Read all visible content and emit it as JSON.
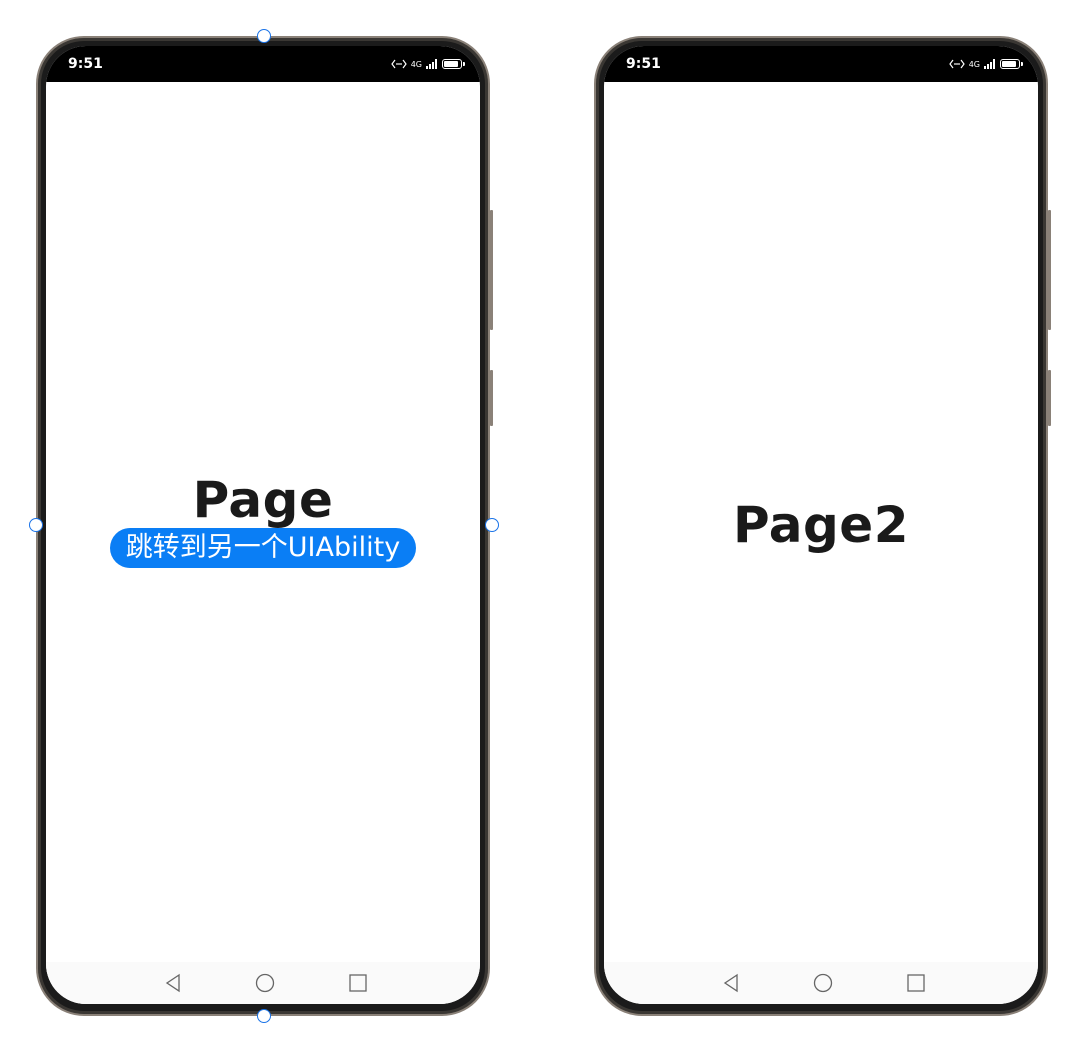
{
  "left_phone": {
    "status_time": "9:51",
    "status_network": "4G",
    "title": "Page",
    "button_label": "跳转到另一个UIAbility"
  },
  "right_phone": {
    "status_time": "9:51",
    "status_network": "4G",
    "title": "Page2"
  },
  "colors": {
    "button_bg": "#0a7ef5",
    "title_text": "#1a1a1a",
    "status_bar": "#000000",
    "selection_handle": "#1a73e8"
  },
  "icons": [
    "back-triangle-icon",
    "home-circle-icon",
    "recent-square-icon",
    "battery-icon",
    "signal-icon",
    "hotspot-icon"
  ]
}
